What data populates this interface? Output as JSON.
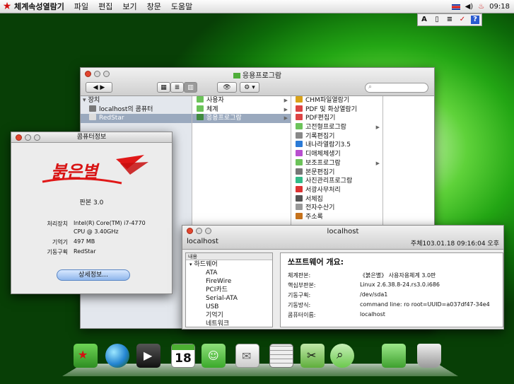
{
  "menubar": {
    "app": "체계속성열람기",
    "items": [
      "파일",
      "편집",
      "보기",
      "창문",
      "도움말"
    ],
    "time": "09:18"
  },
  "tray": {
    "items": [
      "A",
      "▯",
      "≡",
      "✓",
      "?"
    ]
  },
  "finder": {
    "title": "응용프로그람",
    "sidebar": {
      "section": "장치",
      "items": [
        "localhost의 콤퓨터",
        "RedStar"
      ]
    },
    "col2": [
      {
        "label": "사용자",
        "color": "#6cc35a"
      },
      {
        "label": "체계",
        "color": "#6cc35a"
      },
      {
        "label": "응용프로그람",
        "color": "#3f8a3f"
      }
    ],
    "col3": [
      {
        "label": "CHM파일열람기",
        "color": "#d9a21a",
        "arrow": false
      },
      {
        "label": "PDF 및 화상열람기",
        "color": "#d44",
        "arrow": false
      },
      {
        "label": "PDF편집기",
        "color": "#d44",
        "arrow": false
      },
      {
        "label": "고전형프로그람",
        "color": "#6cc35a",
        "arrow": true
      },
      {
        "label": "기록편집기",
        "color": "#888",
        "arrow": false
      },
      {
        "label": "내나라열람기3.5",
        "color": "#2a7ad6",
        "arrow": false
      },
      {
        "label": "디애체체생기",
        "color": "#b84fcf",
        "arrow": false
      },
      {
        "label": "보조프로그람",
        "color": "#6cc35a",
        "arrow": true
      },
      {
        "label": "본문편집기",
        "color": "#777",
        "arrow": false
      },
      {
        "label": "사진관리프로그람",
        "color": "#3b8",
        "arrow": false
      },
      {
        "label": "서광사무처리",
        "color": "#d33",
        "arrow": false
      },
      {
        "label": "서체집",
        "color": "#555",
        "arrow": false
      },
      {
        "label": "전자수산기",
        "color": "#999",
        "arrow": false
      },
      {
        "label": "주소록",
        "color": "#c7731d",
        "arrow": false
      }
    ]
  },
  "about": {
    "title": "콤퓨터정보",
    "logo": "붉은별",
    "version": "판본 3.0",
    "rows": [
      {
        "k": "처리장치",
        "v": "Intel(R) Core(TM) i7-4770"
      },
      {
        "k": "",
        "v": "CPU @ 3.40GHz"
      },
      {
        "k": "기억기",
        "v": "497 MB"
      },
      {
        "k": "기동구획",
        "v": "RedStar"
      }
    ],
    "button": "상세정보..."
  },
  "info": {
    "title": "localhost",
    "host": "localhost",
    "stamp": "주체103.01.18 09:16:04 오후",
    "tree_header": "내용",
    "tree": [
      {
        "label": "하드웨어",
        "top": true
      },
      {
        "label": "ATA"
      },
      {
        "label": "FireWire"
      },
      {
        "label": "PCI카드"
      },
      {
        "label": "Serial-ATA"
      },
      {
        "label": "USB"
      },
      {
        "label": "기억기"
      },
      {
        "label": "네트워크"
      }
    ],
    "heading": "쏘프트웨어 개요:",
    "rows": [
      {
        "k": "체계판본:",
        "v": "《붉은별》 사용자용체계 3.0판"
      },
      {
        "k": "핵심부판본:",
        "v": "Linux 2.6.38.8-24.rs3.0.i686"
      },
      {
        "k": "기동구획:",
        "v": "/dev/sda1"
      },
      {
        "k": "기동방식:",
        "v": "command line: ro root=UUID=a037df47-34e4"
      },
      {
        "k": "콤퓨터이름:",
        "v": "localhost"
      }
    ]
  },
  "dock": {
    "calendar_day": "18"
  },
  "colors": {
    "accent_red": "#d31010",
    "selection": "#9aa9be",
    "desktop": "#23a614"
  }
}
